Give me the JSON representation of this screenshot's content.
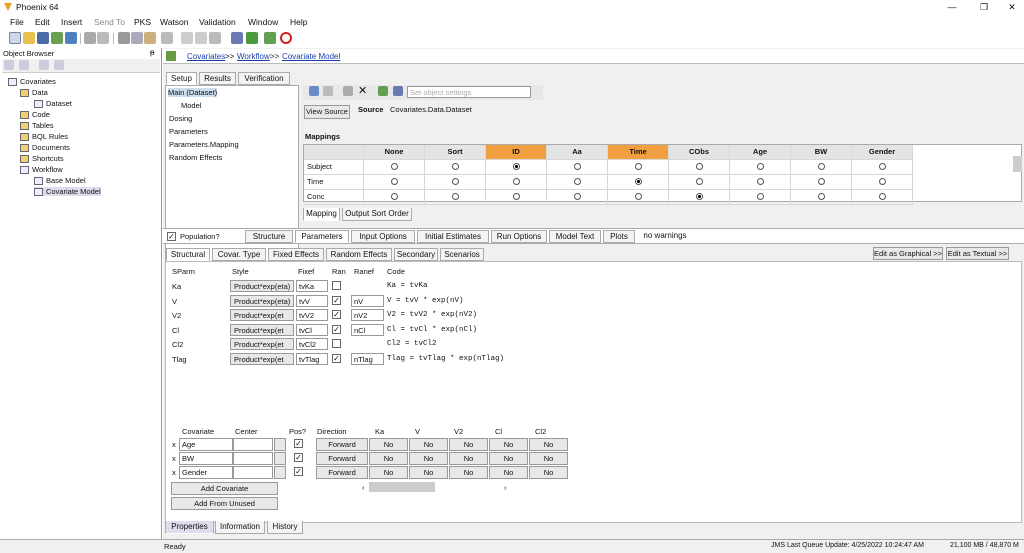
{
  "window": {
    "title": "Phoenix 64",
    "min": "—",
    "max": "❐",
    "close": "✕"
  },
  "menu": [
    "File",
    "Edit",
    "Insert",
    "Send To",
    "PKS",
    "Watson",
    "Validation",
    "Window",
    "Help"
  ],
  "object_browser": {
    "title": "Object Browser",
    "pin": "ᵽ",
    "tree": [
      {
        "label": "Covariates",
        "level": 0
      },
      {
        "label": "Data",
        "level": 1
      },
      {
        "label": "Dataset",
        "level": 2
      },
      {
        "label": "Code",
        "level": 1
      },
      {
        "label": "Tables",
        "level": 1
      },
      {
        "label": "BQL Rules",
        "level": 1
      },
      {
        "label": "Documents",
        "level": 1
      },
      {
        "label": "Shortcuts",
        "level": 1
      },
      {
        "label": "Workflow",
        "level": 1
      },
      {
        "label": "Base Model",
        "level": 2
      },
      {
        "label": "Covariate Model",
        "level": 2
      }
    ]
  },
  "breadcrumb": {
    "p1": "Covariates",
    "sep": ">>",
    "p2": "Workflow",
    "p3": "Covariate Model"
  },
  "top_tabs": [
    "Setup",
    "Results",
    "Verification"
  ],
  "setup_tree": [
    "Main (Dataset)",
    "Model",
    "Dosing",
    "Parameters",
    "Parameters.Mapping",
    "Random Effects"
  ],
  "settings": {
    "set_label": "Set",
    "placeholder": "object settings",
    "view_source": "View Source",
    "source_label": "Source",
    "source_value": "Covariates.Data.Dataset"
  },
  "mappings": {
    "title": "Mappings",
    "columns": [
      "None",
      "Sort",
      "ID",
      "Aa",
      "Time",
      "CObs",
      "Age",
      "BW",
      "Gender"
    ],
    "rows": [
      {
        "name": "Subject",
        "selected": 2
      },
      {
        "name": "Time",
        "selected": 4
      },
      {
        "name": "Conc",
        "selected": 5
      }
    ],
    "tabs": [
      "Mapping",
      "Output Sort Order"
    ]
  },
  "population": {
    "label": "Population?",
    "checked": true
  },
  "model_tabs": [
    "Structure",
    "Parameters",
    "Input Options",
    "Initial Estimates",
    "Run Options",
    "Model Text",
    "Plots",
    "no warnings"
  ],
  "param_tabs": [
    "Structural",
    "Covar. Type",
    "Fixed Effects",
    "Random Effects",
    "Secondary",
    "Scenarios"
  ],
  "edit_buttons": [
    "Edit as Graphical >>",
    "Edit as Textual >>"
  ],
  "struct_headers": [
    "SParm",
    "Style",
    "Fixef",
    "Ran",
    "Ranef",
    "Code"
  ],
  "struct_rows": [
    {
      "sparm": "Ka",
      "style": "Product*exp(eta)",
      "fixef": "tvKa",
      "ran": false,
      "ranef": "",
      "code": "Ka = tvKa"
    },
    {
      "sparm": "V",
      "style": "Product*exp(eta)",
      "fixef": "tvV",
      "ran": true,
      "ranef": "nV",
      "code": "V = tvV * exp(nV)"
    },
    {
      "sparm": "V2",
      "style": "Product*exp(et",
      "fixef": "tvV2",
      "ran": true,
      "ranef": "nV2",
      "code": "V2 = tvV2 * exp(nV2)"
    },
    {
      "sparm": "Cl",
      "style": "Product*exp(et",
      "fixef": "tvCl",
      "ran": true,
      "ranef": "nCl",
      "code": "Cl = tvCl * exp(nCl)"
    },
    {
      "sparm": "Cl2",
      "style": "Product*exp(et",
      "fixef": "tvCl2",
      "ran": false,
      "ranef": "",
      "code": "Cl2 = tvCl2"
    },
    {
      "sparm": "Tlag",
      "style": "Product*exp(et",
      "fixef": "tvTlag",
      "ran": true,
      "ranef": "nTlag",
      "code": "Tlag = tvTlag * exp(nTlag)"
    }
  ],
  "cov_headers": [
    "Covariate",
    "Center",
    "Pos?",
    "Direction",
    "Ka",
    "V",
    "V2",
    "Cl",
    "Cl2"
  ],
  "cov_rows": [
    {
      "x": "x",
      "name": "Age",
      "center": "",
      "pos": true,
      "direction": "Forward",
      "vals": [
        "No",
        "No",
        "No",
        "No",
        "No"
      ]
    },
    {
      "x": "x",
      "name": "BW",
      "center": "",
      "pos": true,
      "direction": "Forward",
      "vals": [
        "No",
        "No",
        "No",
        "No",
        "No"
      ]
    },
    {
      "x": "x",
      "name": "Gender",
      "center": "",
      "pos": true,
      "direction": "Forward",
      "vals": [
        "No",
        "No",
        "No",
        "No",
        "No"
      ]
    }
  ],
  "cov_buttons": [
    "Add Covariate",
    "Add From Unused"
  ],
  "bottom_tabs": [
    "Properties",
    "Information",
    "History"
  ],
  "status": {
    "left": "Ready",
    "queue": "JMS Last Queue Update: 4/25/2022 10:24:47 AM",
    "mem": "21,100 MB / 48,870 M"
  }
}
